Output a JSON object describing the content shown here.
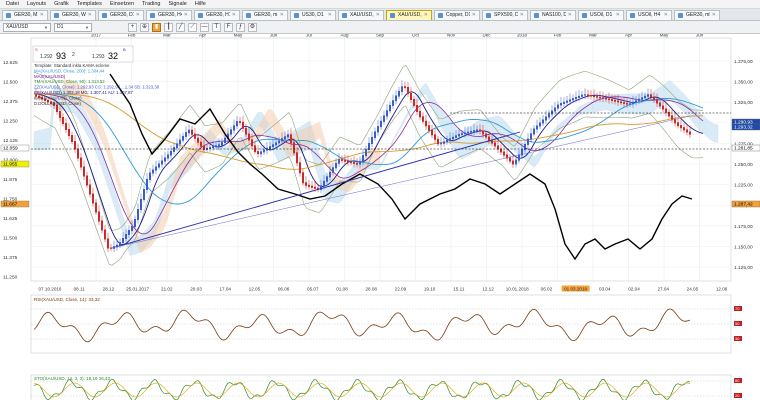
{
  "menu": [
    "Datei",
    "Layouts",
    "Grafik",
    "Templates",
    "Einsetzen",
    "Trading",
    "Signale",
    "Hilfe"
  ],
  "tabs": [
    {
      "label": "GER30, M1",
      "active": false
    },
    {
      "label": "GER30, W1",
      "active": false
    },
    {
      "label": "GER30, D1",
      "active": false
    },
    {
      "label": "GER30, H4",
      "active": false
    },
    {
      "label": "GER30, H1",
      "active": false
    },
    {
      "label": "GER30, m15",
      "active": false
    },
    {
      "label": "US30, D1",
      "active": false
    },
    {
      "label": "XAU/USD, D1",
      "active": false
    },
    {
      "label": "XAU/USD, D1",
      "active": true
    },
    {
      "label": "Copper, D1",
      "active": false
    },
    {
      "label": "SPX500, D1",
      "active": false
    },
    {
      "label": "NAS100, D1",
      "active": false
    },
    {
      "label": "USOil, D1",
      "active": false
    },
    {
      "label": "USOil, H4",
      "active": false
    },
    {
      "label": "GER30, m5",
      "active": false
    }
  ],
  "toolbar": {
    "symbol": "XAU/USD",
    "timeframe": "D1"
  },
  "chart": {
    "top_months": [
      "2017",
      "Feb",
      "Mar",
      "Apr",
      "May",
      "Jun",
      "Jul",
      "Aug",
      "Sep",
      "Oct",
      "Nov",
      "Dec",
      "2018",
      "Feb",
      "Mar",
      "Apr",
      "May",
      "Jun"
    ],
    "bottom_dates": [
      "07.10.2016",
      "08.11",
      "28.12",
      "25.01.2017",
      "21.02",
      "20.03",
      "17.04",
      "12.05",
      "06.06",
      "05.07",
      "01.08",
      "28.08",
      "22.09",
      "19.10",
      "15.11",
      "12.12",
      "10.01.2018",
      "06.02",
      "01.03.2018",
      "03.04",
      "02.04",
      "27.04",
      "24.05",
      "12.06"
    ],
    "right_prices": [
      "1.375,00",
      "1.350,00",
      "1.325,00",
      "1.300,00",
      "1.275,00",
      "1.250,00",
      "1.225,00",
      "1.200,00",
      "1.175,00",
      "1.150,00",
      "1.125,00"
    ],
    "left_prices": [
      "12.625",
      "12.500",
      "12.375",
      "12.250",
      "12.125",
      "12.000",
      "11.875",
      "11.750",
      "11.625",
      "11.500",
      "11.375",
      "11.250"
    ],
    "left_badges": {
      "upper": "12.059",
      "middle": "11.955",
      "lower": "11.667"
    },
    "right_badges": {
      "a": "1.290,93",
      "b": "1.293,32",
      "c": "1.261,85",
      "d": "1.287,42"
    },
    "quote": {
      "bid_main": "1.292",
      "bid_big": "93",
      "spread": "2",
      "ask_main": "1.293",
      "ask_big": "32"
    },
    "legend": [
      "Template: Standard inkla KAMA ecleme",
      "MA(XAU/USD, Close, 200): 1.304,44",
      "MAX(XAU/USD)",
      "TMA(XAU/USD, Close, 50): 1.313,52",
      "ZZ(XAU/USD, Close): 1.292,93  CS: 1.292,93  ...1,34  SB: 1.323,38",
      "BB(XAU/USD)  1.302,18  MG: 1.307,41  AU: 1.307,87",
      "KAMA(XAU/USD, Close)",
      "D.DOLLAR(USD, Close)"
    ],
    "rsi_label": "RSI(XAU/USD, Close, 14): 33,32",
    "rsi_levels": [
      "70",
      "50",
      "30"
    ],
    "stoch_label": "STO(XAU/USD, 14, 3, 3): 19,19  26,43",
    "stoch_levels": [
      "80",
      "20"
    ]
  },
  "colors": {
    "bull": "#3a5fcd",
    "bear": "#cc2a2a",
    "cloud_bull": "#a9d3ef",
    "cloud_bear": "#f3c7a6",
    "trendline": "#2b2bb0",
    "dollar": "#000000",
    "ma200": "#2e9ad6",
    "rsi": "#7a3a10",
    "stoch_k": "#2c8c2c",
    "stoch_d": "#e0a000",
    "date_highlight": "#f4a236"
  }
}
